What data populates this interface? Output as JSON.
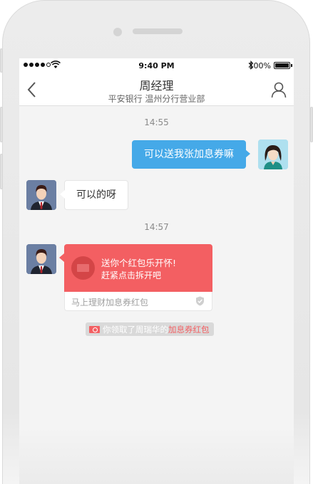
{
  "status_bar": {
    "time": "9:40 PM",
    "battery": "100%"
  },
  "header": {
    "title": "周经理",
    "subtitle": "平安银行 温州分行营业部"
  },
  "messages": {
    "time_1": "14:55",
    "sent_text": "可以送我张加息券嘛",
    "received_text": "可以的呀",
    "time_2": "14:57"
  },
  "red_packet": {
    "title": "送你个红包乐开怀!",
    "subtitle": "赶紧点击拆开吧",
    "footer": "马上理财加息券红包"
  },
  "notice": {
    "text": "你领取了周瑞华的",
    "link": "加息券红包"
  },
  "colors": {
    "sent_bubble": "#45a9e8",
    "red_packet": "#f35f62"
  }
}
